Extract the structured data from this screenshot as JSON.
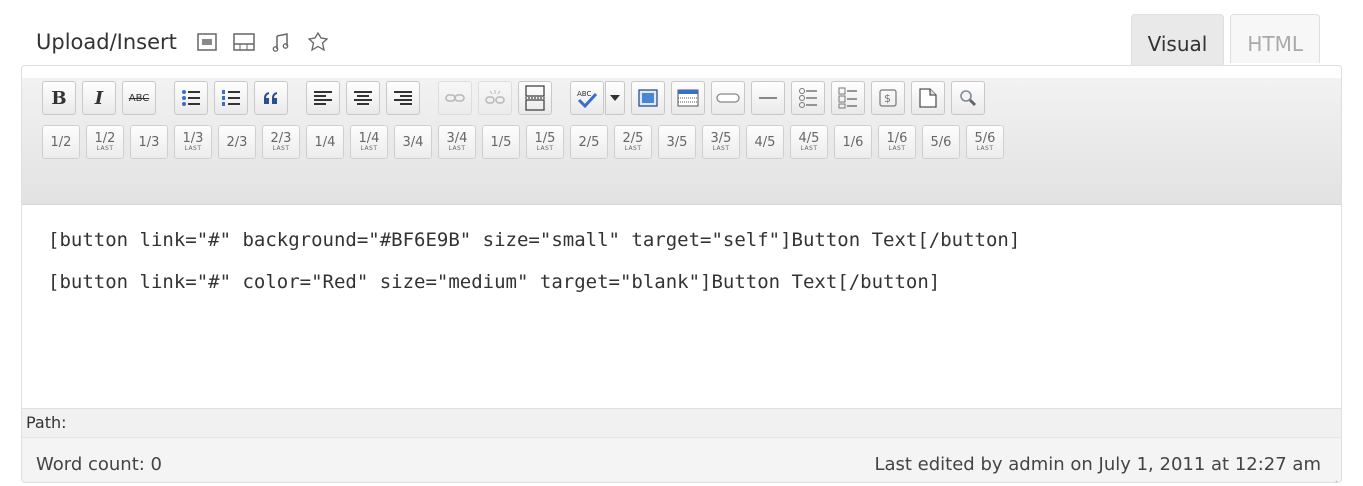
{
  "media": {
    "label": "Upload/Insert",
    "icons": [
      "image-icon",
      "video-icon",
      "audio-icon",
      "media-icon"
    ]
  },
  "tabs": {
    "visual": "Visual",
    "html": "HTML"
  },
  "toolbar": {
    "row1": [
      "bold",
      "italic",
      "strikethrough",
      "bulleted-list",
      "numbered-list",
      "blockquote",
      "align-left",
      "align-center",
      "align-right",
      "insert-link",
      "remove-link",
      "insert-more",
      "spellcheck",
      "fullscreen",
      "insert-table",
      "button-shortcode",
      "divider-shortcode",
      "list-shortcode",
      "ordered-list-shortcode",
      "pricing-shortcode",
      "page-shortcode",
      "search"
    ],
    "bold_label": "B",
    "italic_label": "I",
    "strike_label": "ABC",
    "row2": [
      {
        "v": "1/2",
        "last": false
      },
      {
        "v": "1/2",
        "last": true
      },
      {
        "v": "1/3",
        "last": false
      },
      {
        "v": "1/3",
        "last": true
      },
      {
        "v": "2/3",
        "last": false
      },
      {
        "v": "2/3",
        "last": true
      },
      {
        "v": "1/4",
        "last": false
      },
      {
        "v": "1/4",
        "last": true
      },
      {
        "v": "3/4",
        "last": false
      },
      {
        "v": "3/4",
        "last": true
      },
      {
        "v": "1/5",
        "last": false
      },
      {
        "v": "1/5",
        "last": true
      },
      {
        "v": "2/5",
        "last": false
      },
      {
        "v": "2/5",
        "last": true
      },
      {
        "v": "3/5",
        "last": false
      },
      {
        "v": "3/5",
        "last": true
      },
      {
        "v": "4/5",
        "last": false
      },
      {
        "v": "4/5",
        "last": true
      },
      {
        "v": "1/6",
        "last": false
      },
      {
        "v": "1/6",
        "last": true
      },
      {
        "v": "5/6",
        "last": false
      },
      {
        "v": "5/6",
        "last": true
      }
    ],
    "last_label": "LAST"
  },
  "content": {
    "lines": [
      "[button link=\"#\" background=\"#BF6E9B\" size=\"small\" target=\"self\"]Button Text[/button]",
      "[button link=\"#\" color=\"Red\" size=\"medium\" target=\"blank\"]Button Text[/button]"
    ]
  },
  "path": {
    "label": "Path:"
  },
  "status": {
    "word_count": "Word count: 0",
    "last_edited": "Last edited by admin on July 1, 2011 at 12:27 am"
  },
  "colors": {
    "accent_blue": "#3a6fc7",
    "toolbar_bg": "#e6e6e6",
    "border": "#dfdfdf"
  }
}
